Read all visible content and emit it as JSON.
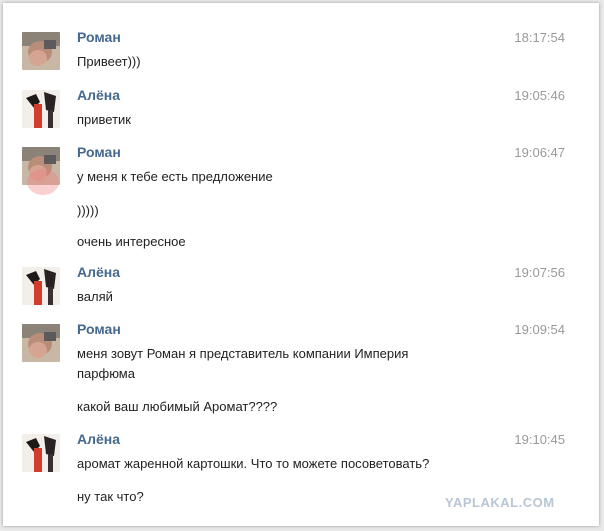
{
  "messages": [
    {
      "sender": "Роман",
      "time": "18:17:54",
      "avatar": "roman",
      "lines": [
        "Привеет)))"
      ]
    },
    {
      "sender": "Алёна",
      "time": "19:05:46",
      "avatar": "alena",
      "lines": [
        "приветик"
      ]
    },
    {
      "sender": "Роман",
      "time": "19:06:47",
      "avatar": "roman",
      "lines": [
        "у меня к тебе есть предложение",
        ")))))",
        "очень интересное"
      ]
    },
    {
      "sender": "Алёна",
      "time": "19:07:56",
      "avatar": "alena",
      "lines": [
        "валяй"
      ]
    },
    {
      "sender": "Роман",
      "time": "19:09:54",
      "avatar": "roman",
      "lines": [
        "меня зовут Роман я представитель компании Империя",
        "парфюма",
        "какой ваш любимый Аромат????"
      ]
    },
    {
      "sender": "Алёна",
      "time": "19:10:45",
      "avatar": "alena",
      "lines": [
        "аромат жаренной картошки. Что то можете посоветовать?",
        "ну так что?"
      ]
    }
  ],
  "watermark": "YAPLAKAL.COM",
  "colors": {
    "sender": "#45688e",
    "time": "#999999",
    "text": "#222222",
    "watermark": "#b7c6d4"
  }
}
